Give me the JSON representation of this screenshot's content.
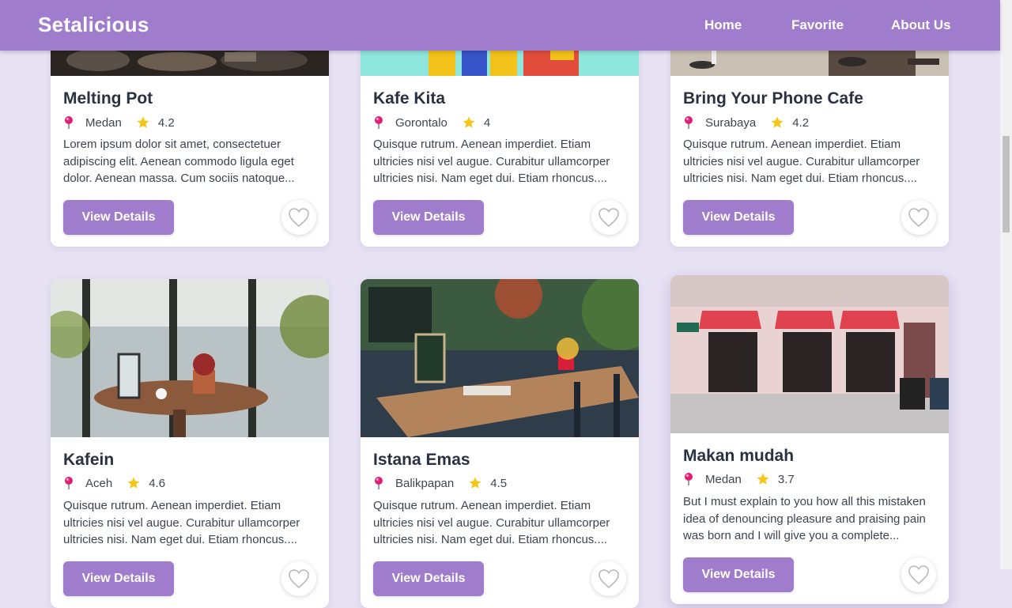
{
  "nav": {
    "brand": "Setalicious",
    "links": [
      "Home",
      "Favorite",
      "About Us"
    ]
  },
  "theme": {
    "accent": "#a07ccd",
    "background": "#e6e1f3",
    "pin": "#e11d74",
    "star": "#f5c518"
  },
  "cards": [
    {
      "title": "Melting Pot",
      "location": "Medan",
      "rating": "4.2",
      "description": "Lorem ipsum dolor sit amet, consectetuer adipiscing elit. Aenean commodo ligula eget dolor. Aenean massa. Cum sociis natoque...",
      "button": "View Details",
      "image": "food-market-photo"
    },
    {
      "title": "Kafe Kita",
      "location": "Gorontalo",
      "rating": "4",
      "description": "Quisque rutrum. Aenean imperdiet. Etiam ultricies nisi vel augue. Curabitur ullamcorper ultricies nisi. Nam eget dui. Etiam rhoncus....",
      "button": "View Details",
      "image": "colorful-storefront-photo"
    },
    {
      "title": "Bring Your Phone Cafe",
      "location": "Surabaya",
      "rating": "4.2",
      "description": "Quisque rutrum. Aenean imperdiet. Etiam ultricies nisi vel augue. Curabitur ullamcorper ultricies nisi. Nam eget dui. Etiam rhoncus....",
      "button": "View Details",
      "image": "cafe-table-photo"
    },
    {
      "title": "Kafein",
      "location": "Aceh",
      "rating": "4.6",
      "description": "Quisque rutrum. Aenean imperdiet. Etiam ultricies nisi vel augue. Curabitur ullamcorper ultricies nisi. Nam eget dui. Etiam rhoncus....",
      "button": "View Details",
      "image": "greenhouse-cafe-photo"
    },
    {
      "title": "Istana Emas",
      "location": "Balikpapan",
      "rating": "4.5",
      "description": "Quisque rutrum. Aenean imperdiet. Etiam ultricies nisi vel augue. Curabitur ullamcorper ultricies nisi. Nam eget dui. Etiam rhoncus....",
      "button": "View Details",
      "image": "garden-cafe-photo"
    },
    {
      "title": "Makan mudah",
      "location": "Medan",
      "rating": "3.7",
      "description": "But I must explain to you how all this mistaken idea of denouncing pleasure and praising pain was born and I will give you a complete...",
      "button": "View Details",
      "image": "pink-shopfront-photo"
    }
  ]
}
